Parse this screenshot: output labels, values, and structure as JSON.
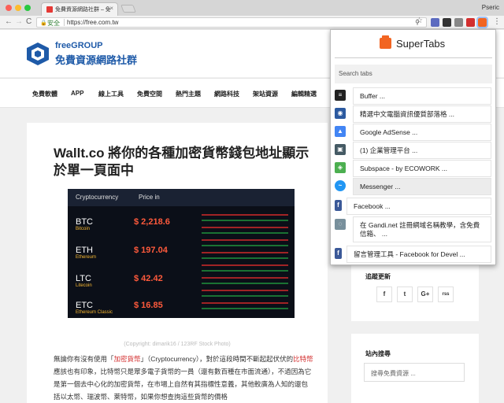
{
  "browser": {
    "tab_title": "免費資源網路社群 – 免費資源網路社群",
    "tab_close": "×",
    "profile_name": "Pseric",
    "back": "←",
    "forward": "→",
    "reload": "C",
    "secure_label": "安全",
    "url": "https://free.com.tw",
    "menu": "⋮"
  },
  "site": {
    "logo_en": "freeGROUP",
    "logo_zh": "免費資源網路社群",
    "nav": [
      "免費軟體",
      "APP",
      "線上工具",
      "免費空間",
      "熱門主題",
      "網路科技",
      "架站資源",
      "編輯精選"
    ]
  },
  "article": {
    "title": "Wallt.co 將你的各種加密貨幣錢包地址顯示於單一頁面中",
    "image": {
      "header_left": "Cryptocurrency",
      "header_mid": "Price in",
      "coins": [
        {
          "sym": "BTC",
          "name": "Bitcoin",
          "price": "$ 2,218.6"
        },
        {
          "sym": "ETH",
          "name": "Ethereum",
          "price": "$ 197.04"
        },
        {
          "sym": "LTC",
          "name": "Litecoin",
          "price": "$ 42.42"
        },
        {
          "sym": "ETC",
          "name": "Ethereum Classic",
          "price": "$ 16.85"
        }
      ]
    },
    "caption": "(Copyright: dimarik16 / 123RF Stock Photo)",
    "p1_a": "無論你有沒有使用「",
    "p1_red1": "加密貨幣",
    "p1_b": "」（Cryptocurrency），對於這段時間不斷起起伏伏的",
    "p1_red2": "比特幣",
    "p1_c": "應該也有印象，比特幣只是眾多電子貨幣的一員（還有數百種在市面流通），不過因為它是第一個去中心化的加密貨幣，在市場上自然有其指標性意義，其他較廣為人知的還包括以太幣、瑞波幣、萊特幣，如果你想查詢這些貨幣的價格"
  },
  "sidebar": {
    "follow_heading": "追蹤更新",
    "social": [
      "f",
      "t",
      "G+",
      "rss"
    ],
    "search_heading": "站內搜尋",
    "search_placeholder": "搜尋免費資源 ..."
  },
  "supertabs": {
    "title": "SuperTabs",
    "search_placeholder": "Search tabs",
    "items": [
      {
        "label": "Buffer ...",
        "icon": "buffer-icon"
      },
      {
        "label": "精選中文電腦資訊優質部落格 ...",
        "icon": "feed-icon"
      },
      {
        "label": "Google AdSense ...",
        "icon": "adsense-icon"
      },
      {
        "label": "(1) 企業管理平台 ...",
        "icon": "business-icon"
      },
      {
        "label": "Subspace - by ECOWORK ...",
        "icon": "subspace-icon"
      },
      {
        "label": "Messenger ...",
        "icon": "messenger-icon"
      },
      {
        "label": "Facebook ...",
        "icon": "facebook-icon"
      },
      {
        "label": "在 Gandi.net 註冊網域名稱教學，含免費信箱、 ...",
        "icon": "gandi-icon"
      },
      {
        "label": "留言管理工具 - Facebook for Devel ...",
        "icon": "facebook-icon"
      }
    ]
  }
}
